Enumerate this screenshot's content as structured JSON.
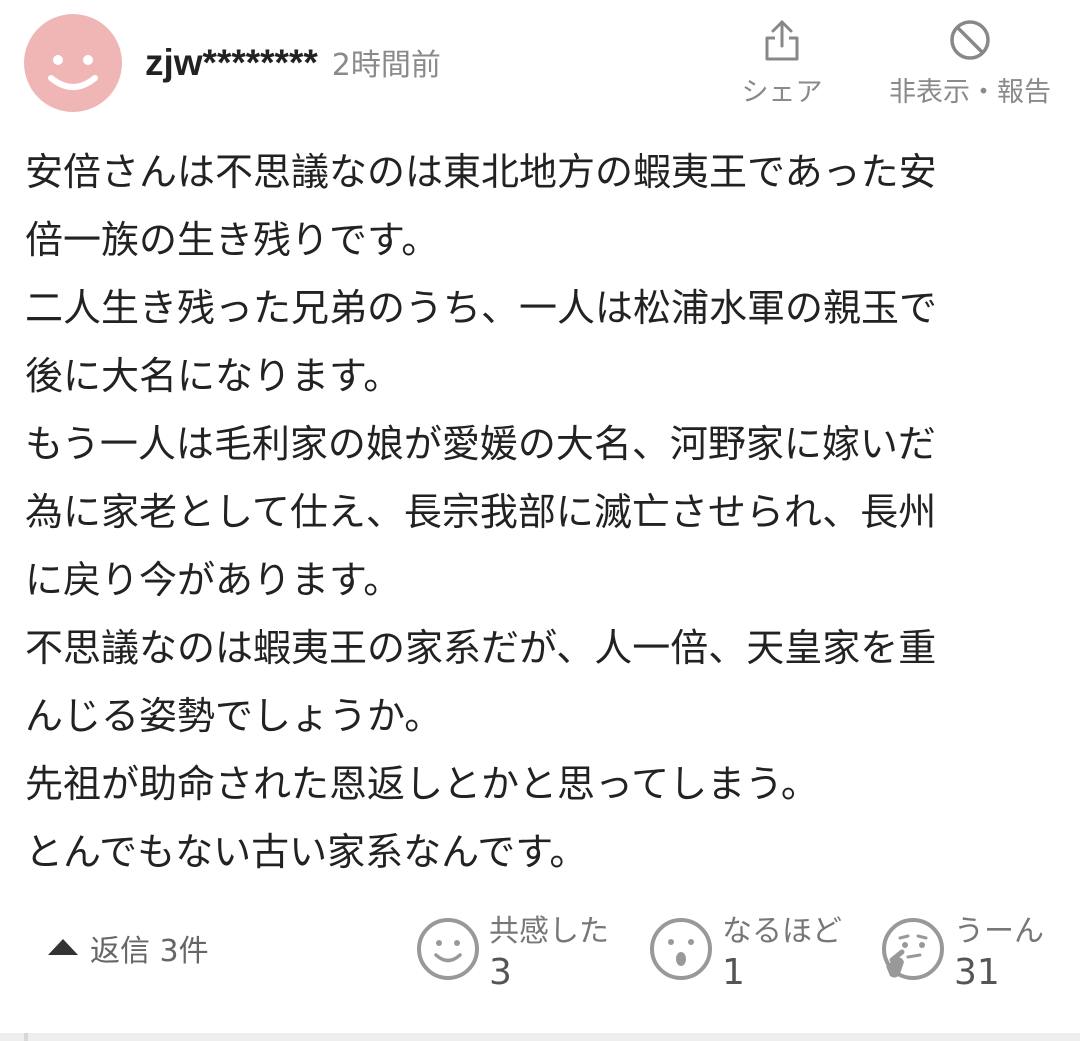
{
  "comment": {
    "username": "zjw********",
    "timestamp": "2時間前",
    "body_lines": [
      "安倍さんは不思議なのは東北地方の蝦夷王であった安",
      "倍一族の生き残りです。",
      "二人生き残った兄弟のうち、一人は松浦水軍の親玉で",
      "後に大名になります。",
      "もう一人は毛利家の娘が愛媛の大名、河野家に嫁いだ",
      "為に家老として仕え、長宗我部に滅亡させられ、長州",
      "に戻り今があります。",
      "不思議なのは蝦夷王の家系だが、人一倍、天皇家を重",
      "んじる姿勢でしょうか。",
      "先祖が助命された恩返しとかと思ってしまう。",
      "とんでもない古い家系なんです。"
    ]
  },
  "actions": {
    "share_label": "シェア",
    "share_icon": "share-icon",
    "hide_label": "非表示・報告",
    "hide_icon": "block-icon"
  },
  "replies": {
    "label": "返信 3件",
    "icon": "triangle-up-icon"
  },
  "reactions": [
    {
      "label": "共感した",
      "count": "3",
      "icon": "smile-face-icon"
    },
    {
      "label": "なるほど",
      "count": "1",
      "icon": "surprised-face-icon"
    },
    {
      "label": "うーん",
      "count": "31",
      "icon": "thinking-face-icon"
    }
  ],
  "colors": {
    "avatar_bg": "#f0b6b6",
    "avatar_face": "#ffffff",
    "muted_text": "#8a8a8a",
    "icon_gray": "#888888"
  }
}
